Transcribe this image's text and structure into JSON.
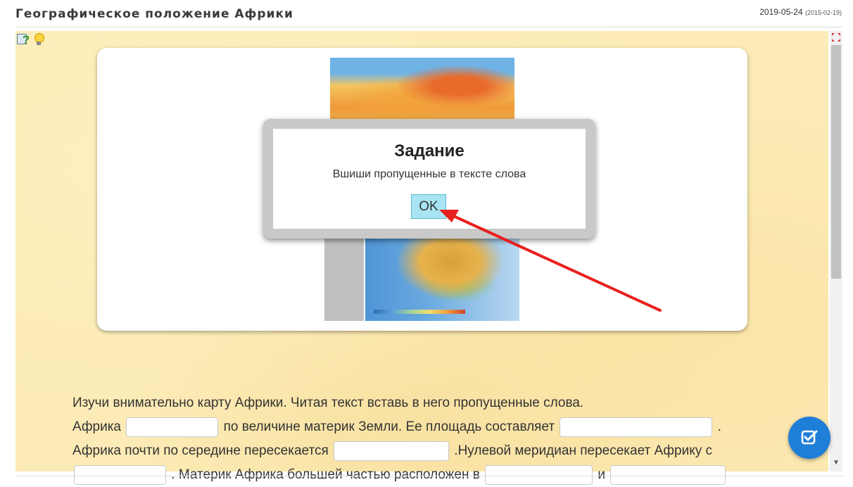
{
  "header": {
    "title": "Географическое положение Африки",
    "date": "2019-05-24",
    "date_secondary": "(2015-02-19)"
  },
  "toolbar": {
    "help_icon": "help-question-icon",
    "hint_icon": "lightbulb-icon",
    "fullscreen_icon": "fullscreen-icon"
  },
  "modal": {
    "title": "Задание",
    "text": "Вшиши пропущенные в тексте слова",
    "ok_label": "OK"
  },
  "exercise": {
    "intro": "Изучи внимательно карту Африки. Читая текст вставь в него пропущенные слова.",
    "line1_a": "Африка",
    "line1_b": "по величине материк Земли. Ее площадь составляет",
    "line1_c": ".",
    "line2_a": "Африка почти по середине пересекается",
    "line2_b": ".Нулевой меридиан пересекает Африку с",
    "line3_a": ". Материк Африка большей частью расположен в",
    "line3_b": "и"
  },
  "colors": {
    "accent": "#1f7fd8",
    "ok_button": "#a8e4f4",
    "arrow": "#e8201e",
    "background": "#fcebb6"
  },
  "fab": {
    "icon": "check-edit-icon"
  }
}
